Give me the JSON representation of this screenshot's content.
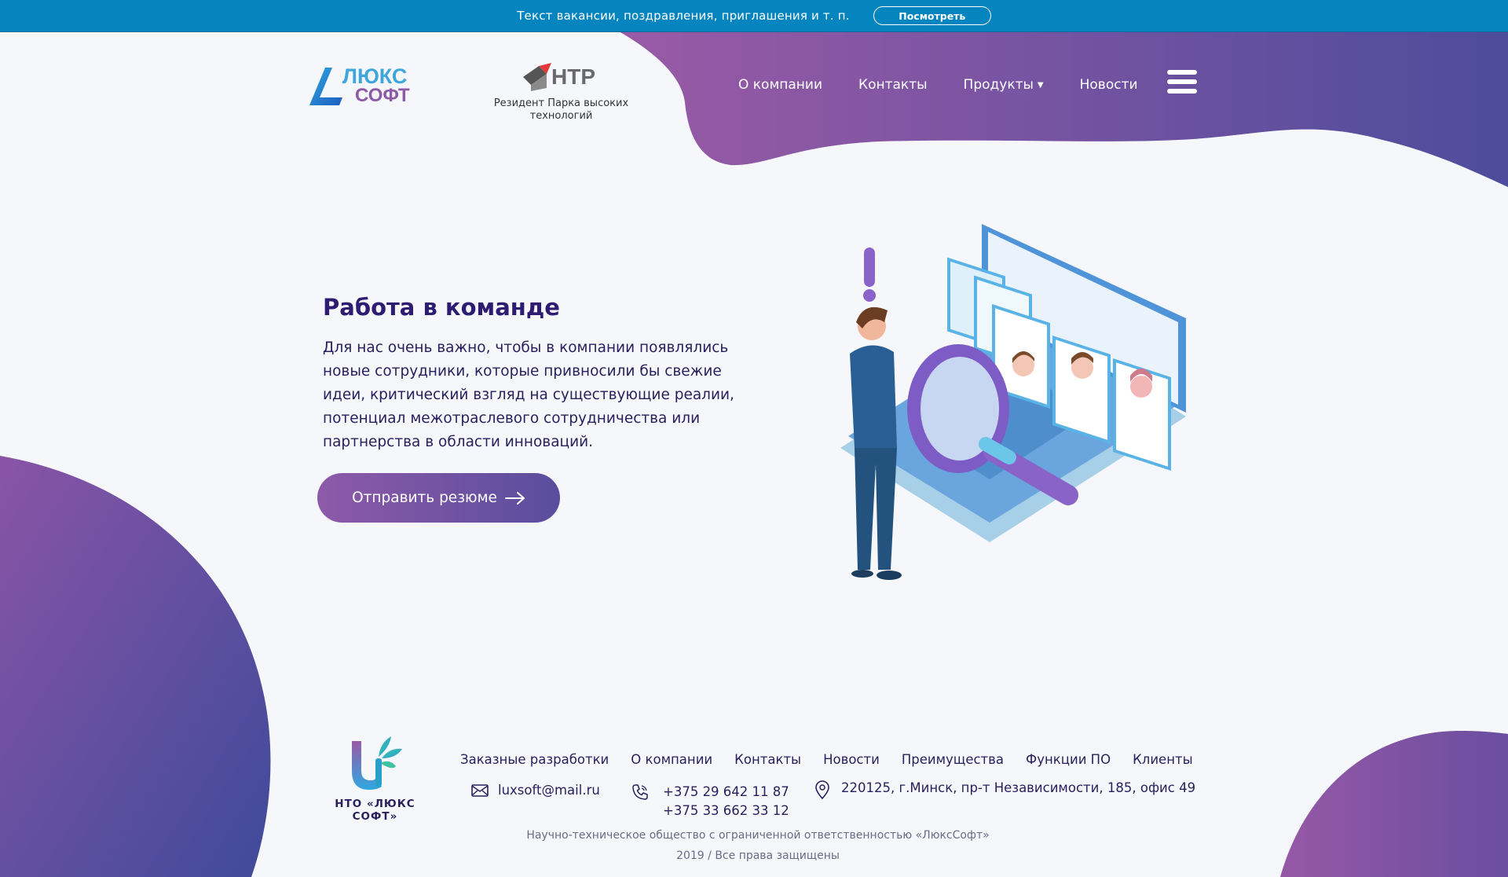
{
  "announcement": {
    "text": "Текст вакансии, поздравления, приглашения и т. п.",
    "button": "Посмотреть"
  },
  "header": {
    "logo_line1": "ЛЮКС",
    "logo_line2": "СОФТ",
    "htp_logo": "HTP",
    "htp_caption": "Резидент Парка высоких технологий",
    "nav": [
      {
        "label": "О компании"
      },
      {
        "label": "Контакты"
      },
      {
        "label": "Продукты"
      },
      {
        "label": "Новости"
      }
    ],
    "menu_icon": "hamburger-icon"
  },
  "hero": {
    "title": "Работа в команде",
    "text": "Для нас очень важно, чтобы в компании появлялись новые сотрудники, которые привносили бы свежие идеи, критический взгляд на существующие реалии, потенциал межотраслевого сотрудничества или партнерства в области инноваций.",
    "cta": "Отправить резюме"
  },
  "footer": {
    "logo_name": "НТО «ЛЮКС СОФТ»",
    "nav": [
      {
        "label": "Заказные разработки"
      },
      {
        "label": "О компании"
      },
      {
        "label": "Контакты"
      },
      {
        "label": "Новости"
      },
      {
        "label": "Преимущества"
      },
      {
        "label": "Функции ПО"
      },
      {
        "label": "Клиенты"
      }
    ],
    "email": "luxsoft@mail.ru",
    "phone1": "+375 29 642 11 87",
    "phone2": "+375 33 662 33 12",
    "address": "220125, г.Минск, пр-т Независимости, 185, офис 49",
    "legal": "Научно-техническое общество с ограниченной ответственностью «ЛюксСофт»",
    "copyright": "2019 / Все права защищены"
  },
  "colors": {
    "topbar": "#0485bf",
    "purple": "#8d5aa8",
    "indigo": "#4e4c9c",
    "heading": "#2e1b72"
  }
}
